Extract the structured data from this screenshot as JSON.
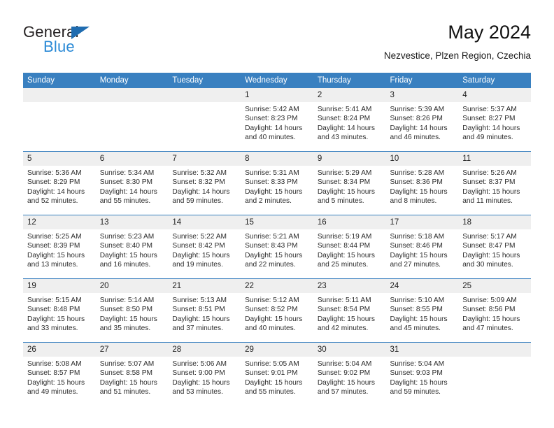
{
  "brand": {
    "name_top": "General",
    "name_bottom": "Blue",
    "triangle_color": "#1f6cb0",
    "blue_text_color": "#2b8ad6"
  },
  "header": {
    "title": "May 2024",
    "subtitle": "Nezvestice, Plzen Region, Czechia"
  },
  "theme": {
    "header_bg": "#3980c0",
    "daynum_bg": "#efefef",
    "row_divider": "#3980c0"
  },
  "weekday_headers": [
    "Sunday",
    "Monday",
    "Tuesday",
    "Wednesday",
    "Thursday",
    "Friday",
    "Saturday"
  ],
  "weeks": [
    [
      {
        "day": "",
        "empty": true,
        "sunrise": "",
        "sunset": "",
        "daylight1": "",
        "daylight2": ""
      },
      {
        "day": "",
        "empty": true,
        "sunrise": "",
        "sunset": "",
        "daylight1": "",
        "daylight2": ""
      },
      {
        "day": "",
        "empty": true,
        "sunrise": "",
        "sunset": "",
        "daylight1": "",
        "daylight2": ""
      },
      {
        "day": "1",
        "sunrise": "Sunrise: 5:42 AM",
        "sunset": "Sunset: 8:23 PM",
        "daylight1": "Daylight: 14 hours",
        "daylight2": "and 40 minutes."
      },
      {
        "day": "2",
        "sunrise": "Sunrise: 5:41 AM",
        "sunset": "Sunset: 8:24 PM",
        "daylight1": "Daylight: 14 hours",
        "daylight2": "and 43 minutes."
      },
      {
        "day": "3",
        "sunrise": "Sunrise: 5:39 AM",
        "sunset": "Sunset: 8:26 PM",
        "daylight1": "Daylight: 14 hours",
        "daylight2": "and 46 minutes."
      },
      {
        "day": "4",
        "sunrise": "Sunrise: 5:37 AM",
        "sunset": "Sunset: 8:27 PM",
        "daylight1": "Daylight: 14 hours",
        "daylight2": "and 49 minutes."
      }
    ],
    [
      {
        "day": "5",
        "sunrise": "Sunrise: 5:36 AM",
        "sunset": "Sunset: 8:29 PM",
        "daylight1": "Daylight: 14 hours",
        "daylight2": "and 52 minutes."
      },
      {
        "day": "6",
        "sunrise": "Sunrise: 5:34 AM",
        "sunset": "Sunset: 8:30 PM",
        "daylight1": "Daylight: 14 hours",
        "daylight2": "and 55 minutes."
      },
      {
        "day": "7",
        "sunrise": "Sunrise: 5:32 AM",
        "sunset": "Sunset: 8:32 PM",
        "daylight1": "Daylight: 14 hours",
        "daylight2": "and 59 minutes."
      },
      {
        "day": "8",
        "sunrise": "Sunrise: 5:31 AM",
        "sunset": "Sunset: 8:33 PM",
        "daylight1": "Daylight: 15 hours",
        "daylight2": "and 2 minutes."
      },
      {
        "day": "9",
        "sunrise": "Sunrise: 5:29 AM",
        "sunset": "Sunset: 8:34 PM",
        "daylight1": "Daylight: 15 hours",
        "daylight2": "and 5 minutes."
      },
      {
        "day": "10",
        "sunrise": "Sunrise: 5:28 AM",
        "sunset": "Sunset: 8:36 PM",
        "daylight1": "Daylight: 15 hours",
        "daylight2": "and 8 minutes."
      },
      {
        "day": "11",
        "sunrise": "Sunrise: 5:26 AM",
        "sunset": "Sunset: 8:37 PM",
        "daylight1": "Daylight: 15 hours",
        "daylight2": "and 11 minutes."
      }
    ],
    [
      {
        "day": "12",
        "sunrise": "Sunrise: 5:25 AM",
        "sunset": "Sunset: 8:39 PM",
        "daylight1": "Daylight: 15 hours",
        "daylight2": "and 13 minutes."
      },
      {
        "day": "13",
        "sunrise": "Sunrise: 5:23 AM",
        "sunset": "Sunset: 8:40 PM",
        "daylight1": "Daylight: 15 hours",
        "daylight2": "and 16 minutes."
      },
      {
        "day": "14",
        "sunrise": "Sunrise: 5:22 AM",
        "sunset": "Sunset: 8:42 PM",
        "daylight1": "Daylight: 15 hours",
        "daylight2": "and 19 minutes."
      },
      {
        "day": "15",
        "sunrise": "Sunrise: 5:21 AM",
        "sunset": "Sunset: 8:43 PM",
        "daylight1": "Daylight: 15 hours",
        "daylight2": "and 22 minutes."
      },
      {
        "day": "16",
        "sunrise": "Sunrise: 5:19 AM",
        "sunset": "Sunset: 8:44 PM",
        "daylight1": "Daylight: 15 hours",
        "daylight2": "and 25 minutes."
      },
      {
        "day": "17",
        "sunrise": "Sunrise: 5:18 AM",
        "sunset": "Sunset: 8:46 PM",
        "daylight1": "Daylight: 15 hours",
        "daylight2": "and 27 minutes."
      },
      {
        "day": "18",
        "sunrise": "Sunrise: 5:17 AM",
        "sunset": "Sunset: 8:47 PM",
        "daylight1": "Daylight: 15 hours",
        "daylight2": "and 30 minutes."
      }
    ],
    [
      {
        "day": "19",
        "sunrise": "Sunrise: 5:15 AM",
        "sunset": "Sunset: 8:48 PM",
        "daylight1": "Daylight: 15 hours",
        "daylight2": "and 33 minutes."
      },
      {
        "day": "20",
        "sunrise": "Sunrise: 5:14 AM",
        "sunset": "Sunset: 8:50 PM",
        "daylight1": "Daylight: 15 hours",
        "daylight2": "and 35 minutes."
      },
      {
        "day": "21",
        "sunrise": "Sunrise: 5:13 AM",
        "sunset": "Sunset: 8:51 PM",
        "daylight1": "Daylight: 15 hours",
        "daylight2": "and 37 minutes."
      },
      {
        "day": "22",
        "sunrise": "Sunrise: 5:12 AM",
        "sunset": "Sunset: 8:52 PM",
        "daylight1": "Daylight: 15 hours",
        "daylight2": "and 40 minutes."
      },
      {
        "day": "23",
        "sunrise": "Sunrise: 5:11 AM",
        "sunset": "Sunset: 8:54 PM",
        "daylight1": "Daylight: 15 hours",
        "daylight2": "and 42 minutes."
      },
      {
        "day": "24",
        "sunrise": "Sunrise: 5:10 AM",
        "sunset": "Sunset: 8:55 PM",
        "daylight1": "Daylight: 15 hours",
        "daylight2": "and 45 minutes."
      },
      {
        "day": "25",
        "sunrise": "Sunrise: 5:09 AM",
        "sunset": "Sunset: 8:56 PM",
        "daylight1": "Daylight: 15 hours",
        "daylight2": "and 47 minutes."
      }
    ],
    [
      {
        "day": "26",
        "sunrise": "Sunrise: 5:08 AM",
        "sunset": "Sunset: 8:57 PM",
        "daylight1": "Daylight: 15 hours",
        "daylight2": "and 49 minutes."
      },
      {
        "day": "27",
        "sunrise": "Sunrise: 5:07 AM",
        "sunset": "Sunset: 8:58 PM",
        "daylight1": "Daylight: 15 hours",
        "daylight2": "and 51 minutes."
      },
      {
        "day": "28",
        "sunrise": "Sunrise: 5:06 AM",
        "sunset": "Sunset: 9:00 PM",
        "daylight1": "Daylight: 15 hours",
        "daylight2": "and 53 minutes."
      },
      {
        "day": "29",
        "sunrise": "Sunrise: 5:05 AM",
        "sunset": "Sunset: 9:01 PM",
        "daylight1": "Daylight: 15 hours",
        "daylight2": "and 55 minutes."
      },
      {
        "day": "30",
        "sunrise": "Sunrise: 5:04 AM",
        "sunset": "Sunset: 9:02 PM",
        "daylight1": "Daylight: 15 hours",
        "daylight2": "and 57 minutes."
      },
      {
        "day": "31",
        "sunrise": "Sunrise: 5:04 AM",
        "sunset": "Sunset: 9:03 PM",
        "daylight1": "Daylight: 15 hours",
        "daylight2": "and 59 minutes."
      },
      {
        "day": "",
        "empty": true,
        "sunrise": "",
        "sunset": "",
        "daylight1": "",
        "daylight2": ""
      }
    ]
  ]
}
